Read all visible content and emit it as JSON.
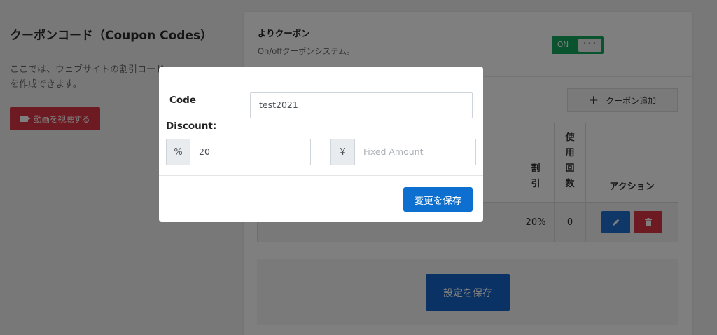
{
  "left": {
    "title": "クーポンコード（Coupon Codes）",
    "description": "ここでは、ウェブサイトの割引コードを作成できます。",
    "video_button": "動画を視聴する"
  },
  "card": {
    "heading": "よりクーポン",
    "subtext": "On/offクーポンシステム。",
    "toggle_on": "ON",
    "toggle_knob": "•••",
    "add_button": "クーポン追加",
    "table": {
      "headers": [
        "",
        "割引",
        "使用回数",
        "アクション"
      ],
      "rows": [
        {
          "code": "",
          "discount": "20%",
          "uses": "0"
        }
      ]
    },
    "save_button": "設定を保存"
  },
  "modal": {
    "code_label": "Code",
    "code_value": "test2021",
    "discount_label": "Discount:",
    "percent_addon": "%",
    "percent_value": "20",
    "yen_addon": "¥",
    "fixed_placeholder": "Fixed Amount",
    "save_button": "変更を保存"
  },
  "colors": {
    "toggle": "#14a65f",
    "primary": "#0d6fd0",
    "danger": "#dc3545"
  }
}
